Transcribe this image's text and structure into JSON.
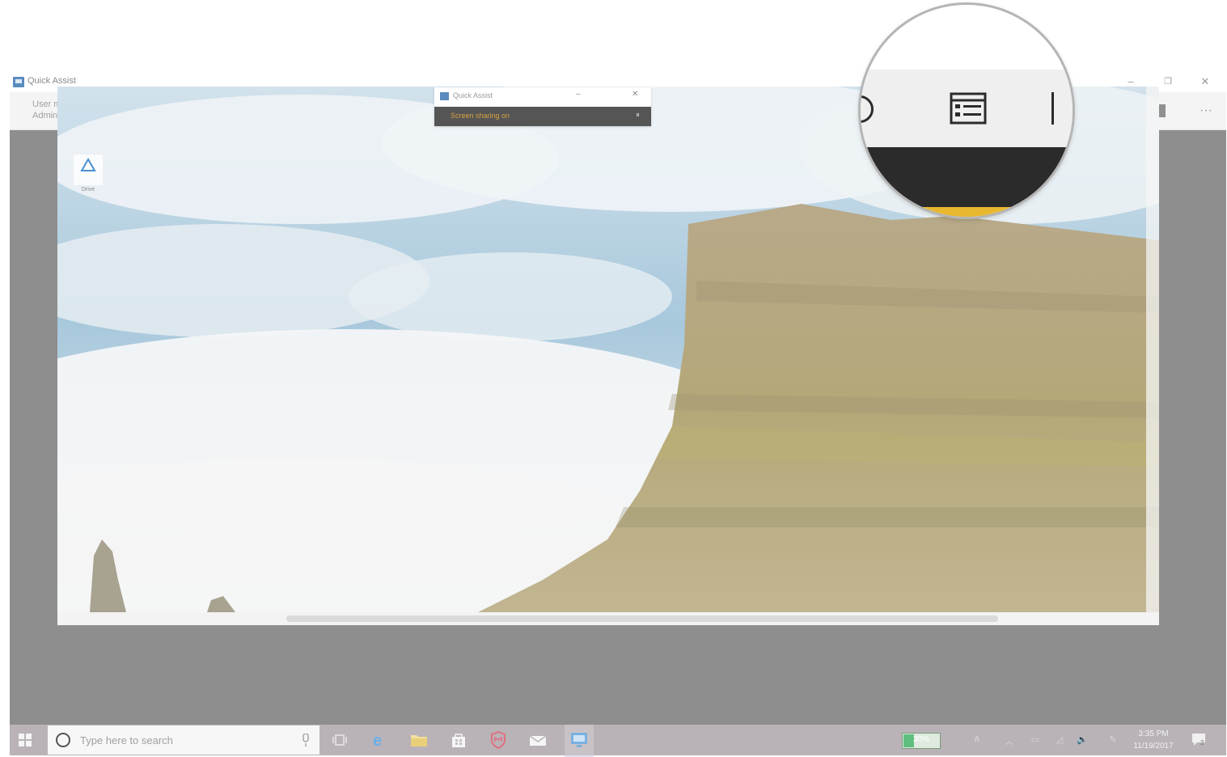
{
  "window": {
    "title": "Quick Assist",
    "controls": {
      "minimize": "–",
      "restore": "❐",
      "close": "✕"
    }
  },
  "toolbar": {
    "user_mode_label": "User mode:",
    "user_mode_value": "Administrator",
    "buttons": [
      "select-monitor",
      "annotate",
      "actual-size",
      "toggle-instruction-channel",
      "restart",
      "task-manager",
      "pause",
      "end",
      "more"
    ],
    "more_label": "···"
  },
  "remote_session": {
    "mini_window": {
      "title": "Quick Assist",
      "status_text": "Screen sharing on",
      "minimize": "–",
      "close": "✕",
      "pause": "⏸"
    },
    "desktop_icon_label": "Drive"
  },
  "taskbar": {
    "search_placeholder": "Type here to search",
    "apps": [
      "task-view",
      "edge",
      "file-explorer",
      "store",
      "mcafee",
      "mail",
      "quick-assist"
    ],
    "battery_percent": "30%",
    "battery_level": 0.3,
    "time": "3:35 PM",
    "date": "11/19/2017",
    "notification_count": "2"
  },
  "magnifier": {
    "highlighted_button": "toggle-instruction-channel"
  },
  "colors": {
    "toolbar_bg": "#f4f4f4",
    "window_gray": "#8e8e8e",
    "taskbar_bg": "#b9b3b8",
    "accent_yellow": "#e8b830",
    "status_orange": "#d8a040"
  }
}
